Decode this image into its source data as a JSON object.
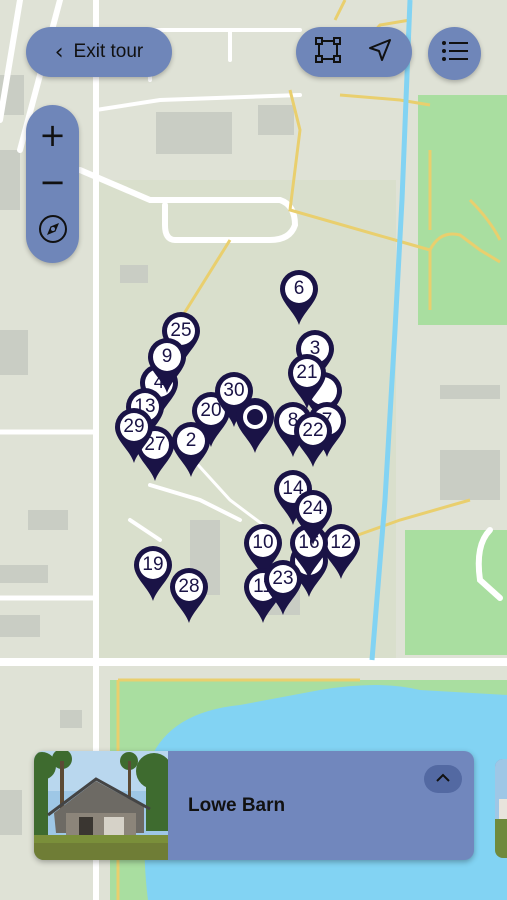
{
  "header": {
    "exit_label": "Exit tour",
    "exit_icon": "chevron-left-icon",
    "tool_icons": [
      "select-area-icon",
      "navigate-arrow-icon"
    ],
    "list_icon": "list-icon"
  },
  "zoom": {
    "in": "+",
    "out": "−",
    "compass_icon": "compass-icon"
  },
  "stops": [
    "6",
    "3",
    "21",
    "25",
    "9",
    "4",
    "13",
    "29",
    "27",
    "2",
    "20",
    "30",
    "8",
    "7",
    "22",
    "14",
    "24",
    "10",
    "16",
    "12",
    "19",
    "28",
    "11",
    "23"
  ],
  "current_stop": {
    "title": "Lowe Barn",
    "expand_icon": "chevron-up-icon"
  },
  "colors": {
    "ui_accent": "#6f86b9",
    "pin": "#1a1346",
    "water": "#82d3f3",
    "park": "#a9dea0",
    "road": "#ffffff",
    "path": "#e9cf6e"
  }
}
